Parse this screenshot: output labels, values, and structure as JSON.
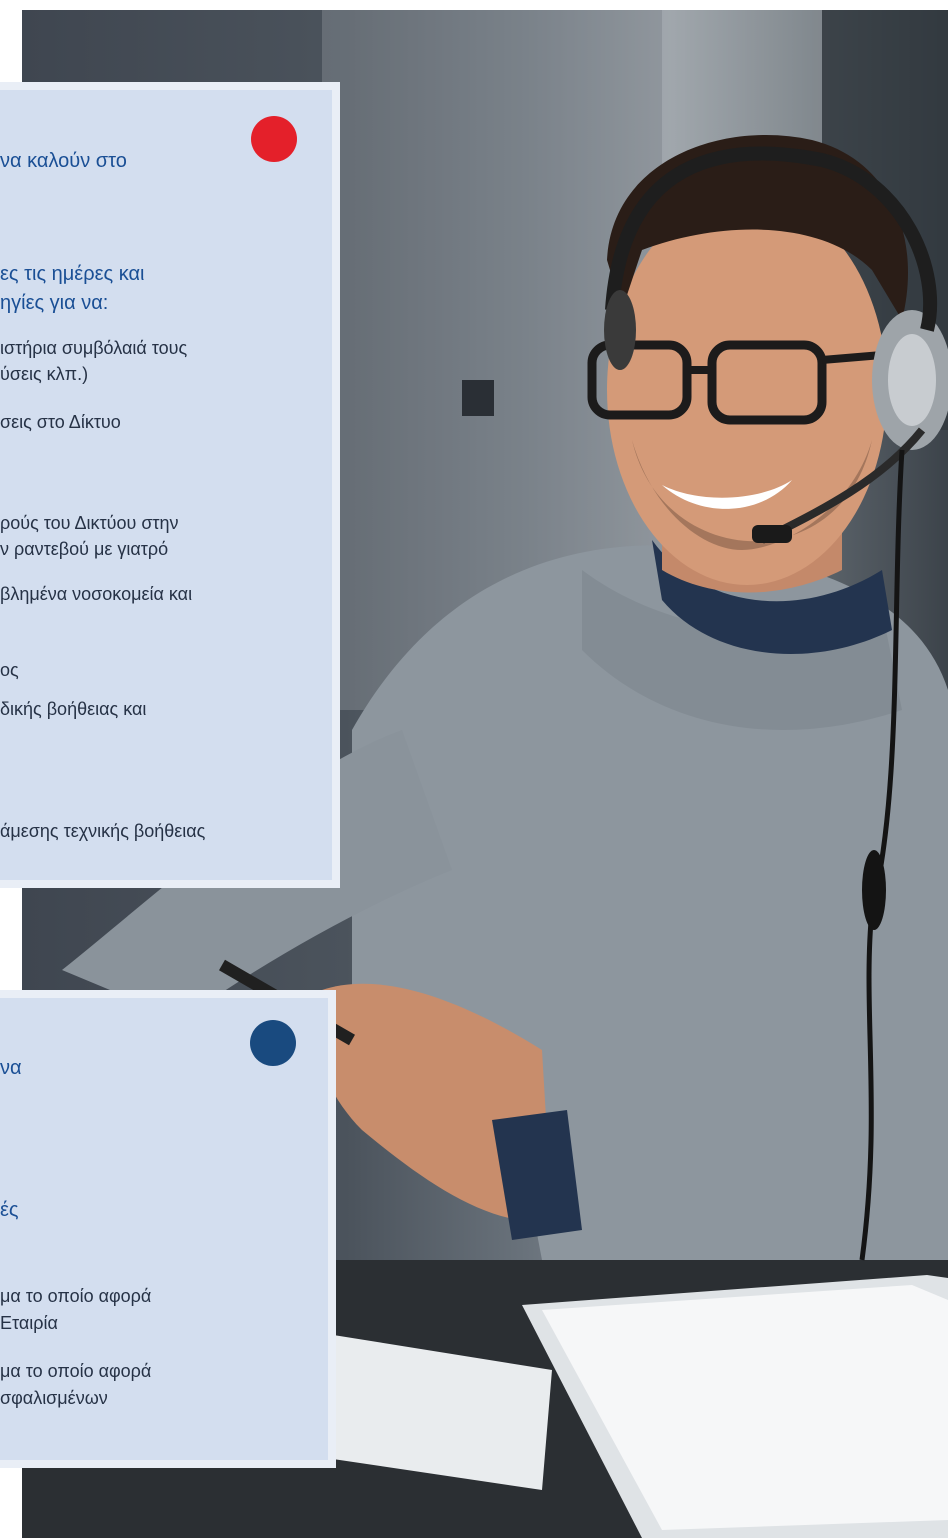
{
  "colors": {
    "heading_blue": "#1a4f95",
    "dot_red": "#e4202a",
    "dot_navy": "#194a7f",
    "card_bg": "#d3deef",
    "card_border": "#e9eef6"
  },
  "card1": {
    "heading1": "να καλούν στο",
    "heading2_line1": "ες τις ημέρες και",
    "heading2_line2": "ηγίες για να:",
    "items": [
      "ιστήρια συμβόλαιά τους",
      "ύσεις κλπ.)",
      "σεις στο Δίκτυο",
      "ρούς του Δικτύου στην",
      "ν ραντεβού με γιατρό",
      "βλημένα νοσοκομεία και",
      "ος",
      "δικής βοήθειας και",
      "άμεσης τεχνικής βοήθειας"
    ]
  },
  "card2": {
    "heading1": "να",
    "heading2": "ές",
    "items": [
      "μα το οποίο αφορά",
      "Εταιρία",
      "μα το οποίο αφορά",
      "σφαλισμένων"
    ]
  }
}
